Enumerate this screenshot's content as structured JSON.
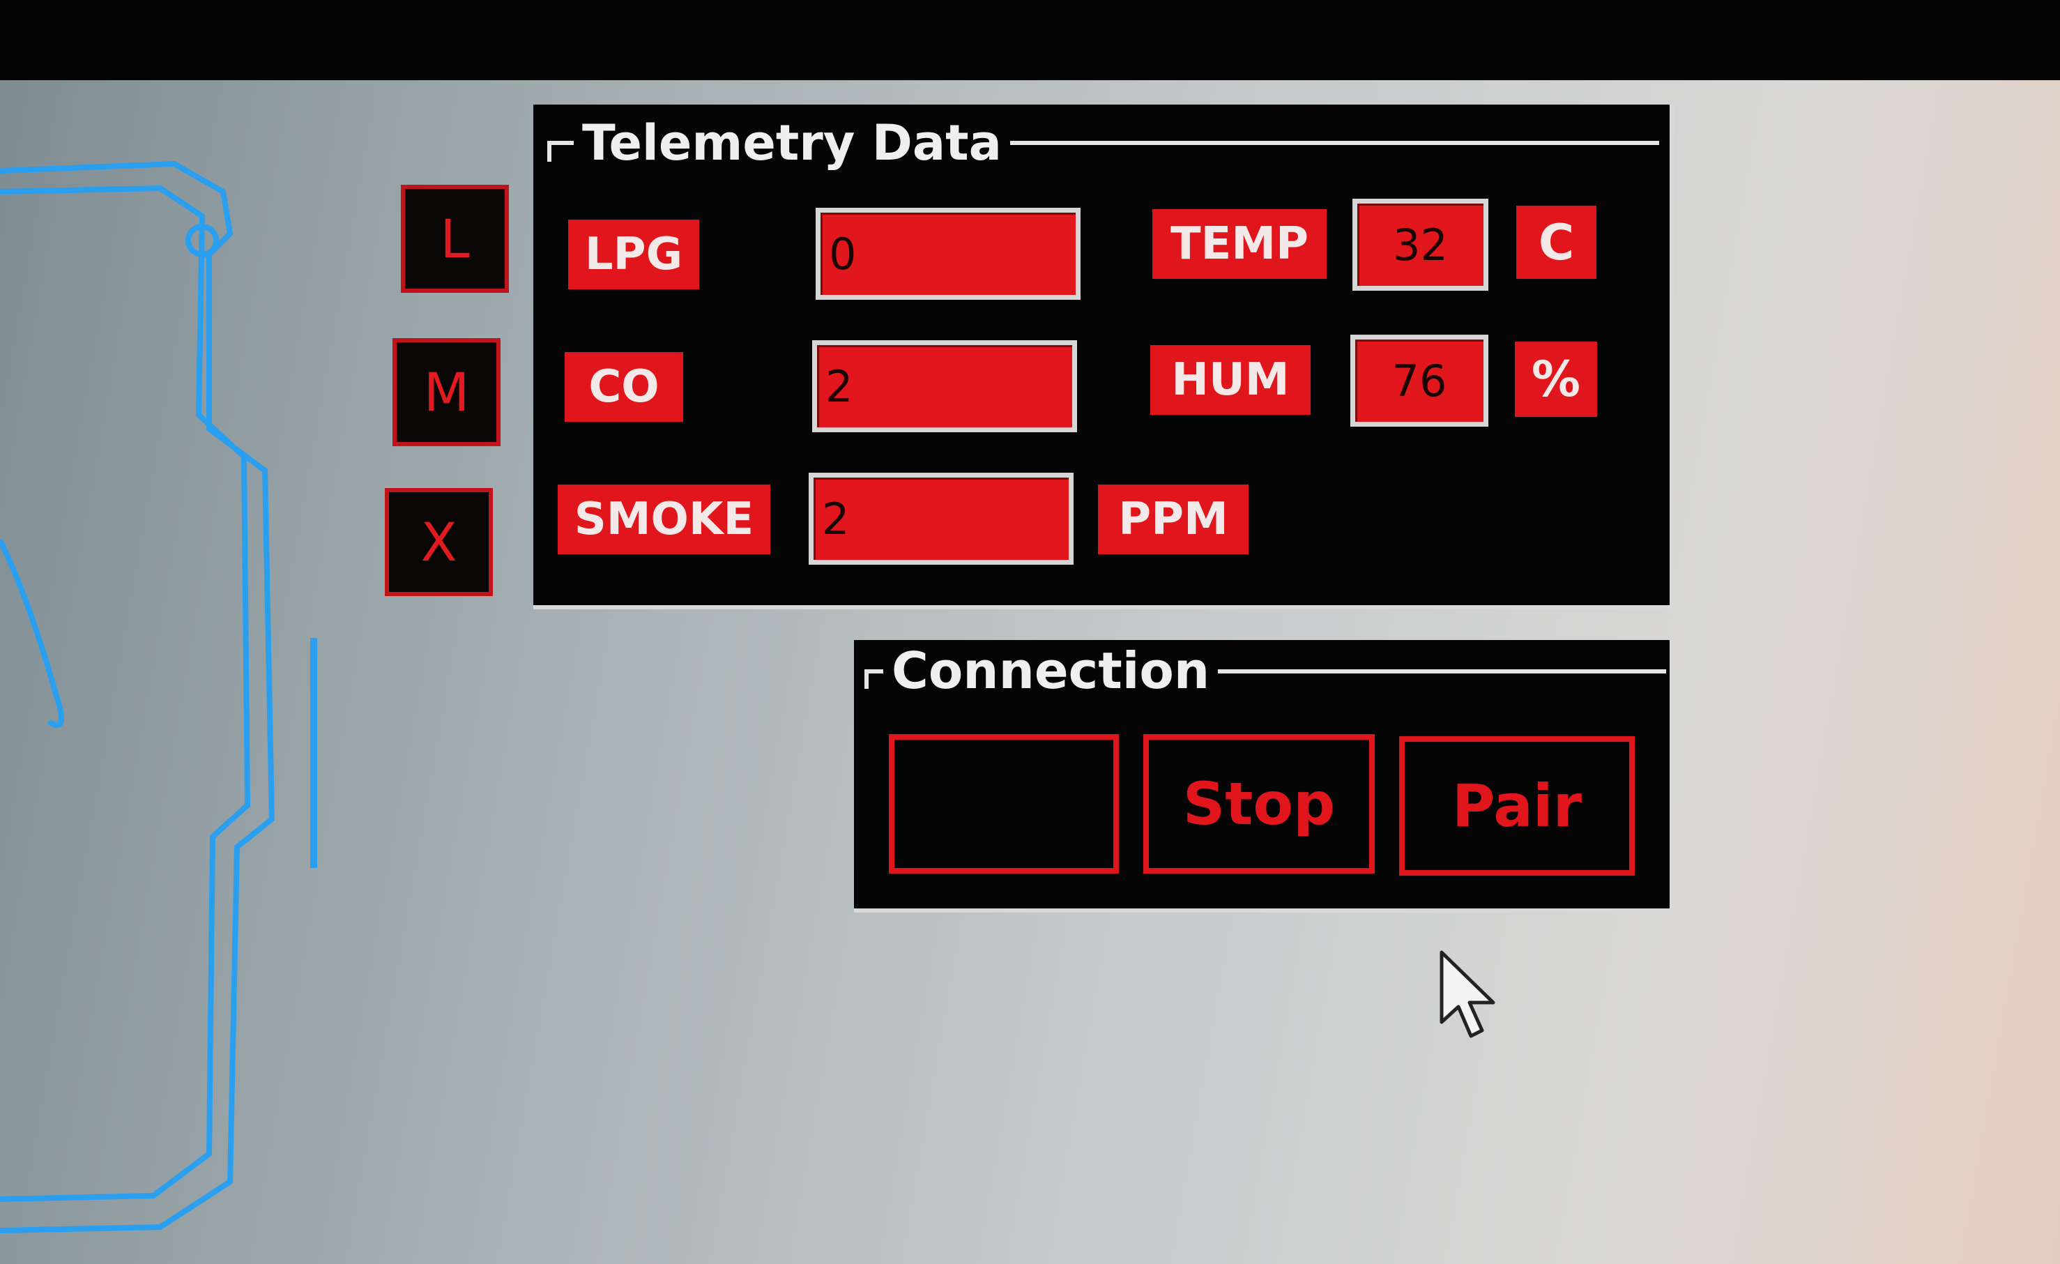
{
  "side_buttons": {
    "l": "L",
    "m": "M",
    "x": "X"
  },
  "telemetry": {
    "title": "Telemetry Data",
    "lpg": {
      "label": "LPG",
      "value": "0"
    },
    "co": {
      "label": "CO",
      "value": "2"
    },
    "smoke": {
      "label": "SMOKE",
      "value": "2"
    },
    "ppm_unit": "PPM",
    "temp": {
      "label": "TEMP",
      "value": "32",
      "unit": "C"
    },
    "hum": {
      "label": "HUM",
      "value": "76",
      "unit": "%"
    }
  },
  "connection": {
    "title": "Connection",
    "blank_label": "",
    "stop_label": "Stop",
    "pair_label": "Pair"
  },
  "colors": {
    "accent_red": "#e0161c",
    "panel_black": "#050505",
    "hologram_blue": "#2a9ff0"
  },
  "icons": {
    "cursor": "mouse-pointer-icon",
    "backdrop": "phone-outline-graphic"
  }
}
